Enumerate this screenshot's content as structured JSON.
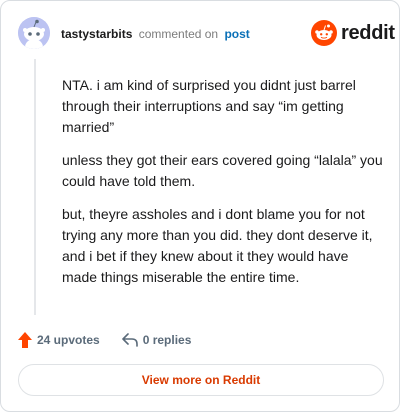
{
  "header": {
    "username": "tastystarbits",
    "action": "commented on",
    "post_link": "post",
    "brand": "reddit"
  },
  "comment": {
    "paragraphs": [
      "NTA. i am kind of surprised you didnt just barrel through their interruptions and say “im getting married”",
      "unless they got their ears covered going “lalala” you could have told them.",
      "but, theyre assholes and i dont blame you for not trying any more than you did. they dont deserve it, and i bet if they knew about it they would have made things miserable the entire time."
    ]
  },
  "footer": {
    "upvotes": "24 upvotes",
    "replies": "0 replies",
    "upvote_icon": "arrow-up-icon",
    "reply_icon": "reply-arrow-icon"
  },
  "cta": {
    "label": "View more on Reddit"
  },
  "colors": {
    "brand_orange": "#ff4500",
    "upvote_orange": "#ff4500",
    "link_blue": "#0a70b7",
    "cta_text": "#d93a00",
    "avatar_bg": "#bcc3f2"
  }
}
